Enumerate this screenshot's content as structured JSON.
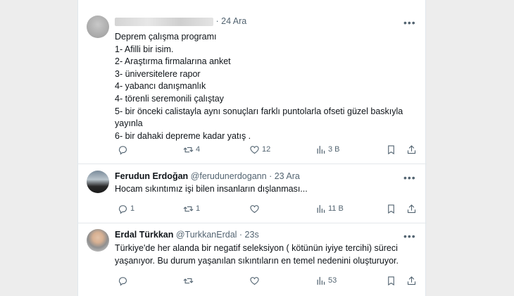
{
  "tweets": [
    {
      "date": "· 24 Ara",
      "lines": [
        "Deprem çalışma programı",
        "1- Afilli bir isim.",
        "2- Araştırma firmalarına anket",
        "3- üniversitelere rapor",
        "4- yabancı danışmanlık",
        "4- törenli seremonili çalıştay",
        "5- bir önceki calistayla aynı sonuçları farklı puntolarla ofseti güzel baskıyla",
        "yayınla",
        "6- bir dahaki depreme kadar yatış ."
      ],
      "replies": "",
      "retweets": "4",
      "likes": "12",
      "views": "3 B"
    },
    {
      "name": "Ferudun Erdoğan",
      "handle": "@ferudunerdogann",
      "date": "· 23 Ara",
      "lines": [
        "Hocam sıkıntımız işi bilen insanların dışlanması..."
      ],
      "replies": "1",
      "retweets": "1",
      "likes": "",
      "views": "11 B"
    },
    {
      "name": "Erdal Türkkan",
      "handle": "@TurkkanErdal",
      "date": "· 23s",
      "lines": [
        "Türkiye'de her alanda bir negatif seleksiyon  ( kötünün iyiye tercihi) süreci",
        "yaşanıyor. Bu durum  yaşanılan sıkıntıların en temel nedenini oluşturuyor."
      ],
      "replies": "",
      "retweets": "",
      "likes": "",
      "views": "53"
    }
  ],
  "icons": {
    "more": "more-icon",
    "reply": "reply-icon",
    "retweet": "retweet-icon",
    "like": "like-icon",
    "views": "views-icon",
    "bookmark": "bookmark-icon",
    "share": "share-icon"
  },
  "colors": {
    "text": "#0f1419",
    "muted": "#536471",
    "page_bg": "#ededed"
  }
}
